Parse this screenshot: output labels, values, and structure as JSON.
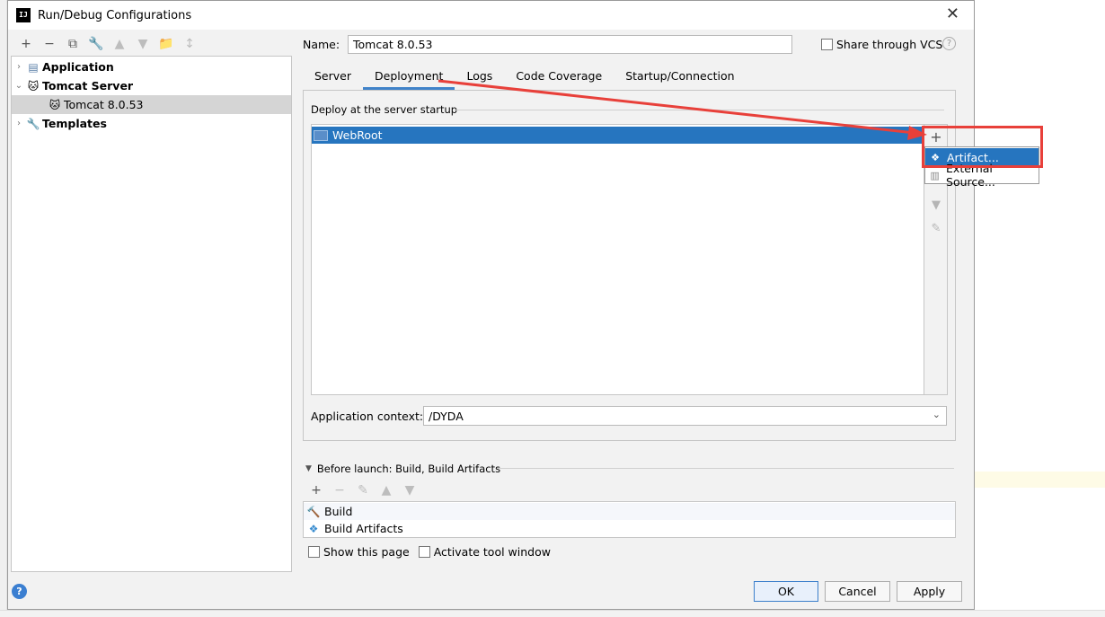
{
  "window": {
    "title": "Run/Debug Configurations",
    "app_icon": "IJ"
  },
  "left_toolbar": {
    "buttons": [
      {
        "name": "add-icon",
        "glyph": "+"
      },
      {
        "name": "remove-icon",
        "glyph": "−"
      },
      {
        "name": "copy-icon",
        "glyph": "⧉"
      },
      {
        "name": "wrench-icon",
        "glyph": "🔧"
      },
      {
        "name": "move-up-icon",
        "glyph": "▲"
      },
      {
        "name": "move-down-icon",
        "glyph": "▼"
      },
      {
        "name": "folder-add-icon",
        "glyph": "📁"
      },
      {
        "name": "sort-icon",
        "glyph": "↕"
      }
    ]
  },
  "tree": {
    "items": [
      {
        "label": "Application",
        "chevron": "›",
        "icon": "▤"
      },
      {
        "label": "Tomcat Server",
        "chevron": "⌄",
        "icon": "🐱"
      },
      {
        "label": "Tomcat 8.0.53",
        "icon": "🐱"
      },
      {
        "label": "Templates",
        "chevron": "›",
        "icon": "🔧"
      }
    ]
  },
  "name": {
    "label": "Name:",
    "value": "Tomcat 8.0.53"
  },
  "share": {
    "label": "Share through VCS",
    "help": "?"
  },
  "tabs": [
    "Server",
    "Deployment",
    "Logs",
    "Code Coverage",
    "Startup/Connection"
  ],
  "deployment": {
    "section_label": "Deploy at the server startup",
    "items": [
      "WebRoot"
    ],
    "side_buttons": {
      "add": "+",
      "down": "▼",
      "edit": "✎"
    },
    "popup": [
      {
        "label": "Artifact...",
        "icon": "❖"
      },
      {
        "label": "External Source...",
        "icon": "▥"
      }
    ]
  },
  "context": {
    "label": "Application context:",
    "value": "/DYDA"
  },
  "before_launch": {
    "label": "Before launch: Build, Build Artifacts",
    "toolbar": [
      "+",
      "−",
      "✎",
      "▲",
      "▼"
    ],
    "items": [
      {
        "label": "Build",
        "icon": "🔨"
      },
      {
        "label": "Build Artifacts",
        "icon": "❖"
      }
    ]
  },
  "options": {
    "show_page": "Show this page",
    "activate_tool": "Activate tool window"
  },
  "buttons": {
    "ok": "OK",
    "cancel": "Cancel",
    "apply": "Apply",
    "help": "?"
  },
  "colors": {
    "selection": "#2675bf",
    "annotation": "#e8403a",
    "tab_underline": "#4083c9"
  }
}
